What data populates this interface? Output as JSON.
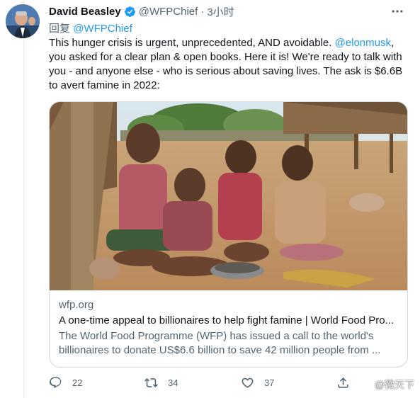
{
  "tweet": {
    "author_name": "David Beasley",
    "author_handle": "@WFPChief",
    "separator": "·",
    "time": "3小时",
    "reply_prefix": "回复",
    "reply_to": "@WFPChief",
    "text_part1": "This hunger crisis is urgent, unprecedented, AND avoidable. ",
    "text_mention": "@elonmusk",
    "text_part2": ",\nyou asked for a clear plan & open books. Here it is! We're ready to talk with\nyou - and anyone else - who is serious about saving lives. The ask is $6.6B\nto avert famine in 2022:"
  },
  "card": {
    "domain": "wfp.org",
    "title": "A one-time appeal to billionaires to help fight famine | World Food Pro...",
    "description_line1": "The World Food Programme (WFP) has issued a call to the world's",
    "description_line2": "billionaires to donate US$6.6 billion to save 42 million people from ..."
  },
  "actions": {
    "replies": "22",
    "retweets": "34",
    "likes": "37"
  },
  "watermark": {
    "text": "@微天下"
  },
  "icons": {
    "verified": "verified-badge-icon",
    "more": "more-icon",
    "reply": "reply-icon",
    "retweet": "retweet-icon",
    "like": "like-icon",
    "share": "share-icon"
  },
  "colors": {
    "link": "#1d9bf0",
    "secondary_text": "#536471",
    "primary_text": "#0f1419"
  }
}
